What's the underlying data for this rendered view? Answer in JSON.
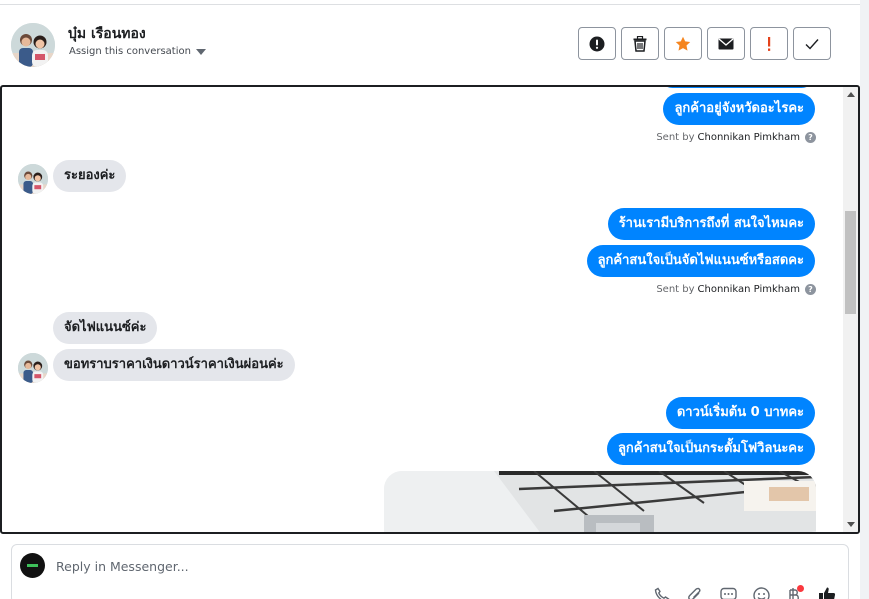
{
  "header": {
    "contact_name": "บุ๋ม เรือนทอง",
    "assign_label": "Assign this conversation",
    "actions": [
      {
        "name": "mark-spam-button",
        "icon": "alert-circle-icon"
      },
      {
        "name": "delete-button",
        "icon": "trash-icon"
      },
      {
        "name": "star-button",
        "icon": "star-icon",
        "color": "#f5851f"
      },
      {
        "name": "mark-unread-button",
        "icon": "envelope-icon"
      },
      {
        "name": "mark-important-button",
        "icon": "exclamation-icon",
        "color": "#e4421b"
      },
      {
        "name": "mark-done-button",
        "icon": "checkmark-icon"
      }
    ]
  },
  "messages": [
    {
      "from": "page",
      "text": "ลูกค้าอยู่จังหวัดอะไรคะ"
    },
    {
      "from": "page_meta",
      "sent_by_prefix": "Sent by",
      "sent_by_name": "Chonnikan Pimkham"
    },
    {
      "from": "customer",
      "text": "ระยองค่ะ"
    },
    {
      "from": "page",
      "text": "ร้านเรามีบริการถึงที่ สนใจไหมคะ"
    },
    {
      "from": "page",
      "text": "ลูกค้าสนใจเป็นจัดไฟแนนซ์หรือสดคะ"
    },
    {
      "from": "page_meta",
      "sent_by_prefix": "Sent by",
      "sent_by_name": "Chonnikan Pimkham"
    },
    {
      "from": "customer",
      "text": "จัดไฟแนนซ์ค่ะ"
    },
    {
      "from": "customer",
      "text": "ขอทราบราคาเงินดาวน์ราคาเงินผ่อนค่ะ"
    },
    {
      "from": "page",
      "text": "ดาวน์เริ่มต้น 0 บาทคะ"
    },
    {
      "from": "page",
      "text": "ลูกค้าสนใจเป็นกระดั้มโฟวิลนะคะ"
    },
    {
      "from": "page",
      "type": "image"
    }
  ],
  "composer": {
    "placeholder": "Reply in Messenger...",
    "tools": [
      "phone-icon",
      "paperclip-icon",
      "saved-reply-icon",
      "emoji-icon",
      "baht-payment-icon",
      "thumbs-up-icon"
    ]
  },
  "colors": {
    "outgoing_bubble": "#0084ff",
    "incoming_bubble": "#e4e6eb",
    "notification_dot": "#fa383e"
  }
}
